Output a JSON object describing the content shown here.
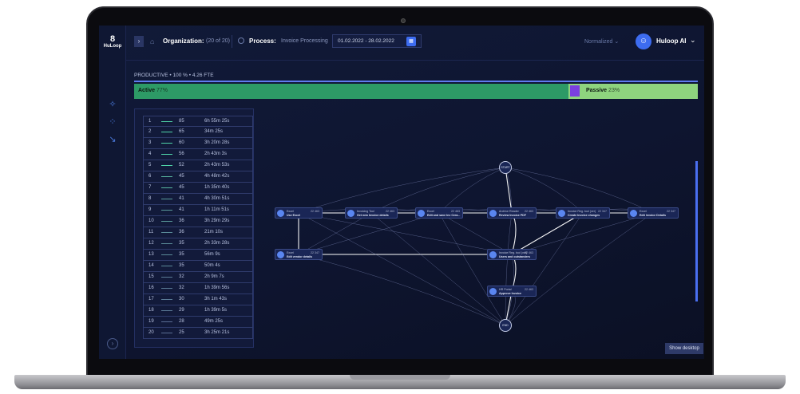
{
  "app": {
    "logo_mark": "8",
    "logo_text": "HuLoop"
  },
  "topbar": {
    "collapse_glyph": "›",
    "organization_label": "Organization:",
    "organization_value": "(20 of 20)",
    "process_label": "Process:",
    "process_value": "Invoice Processing",
    "date_range": "01.02.2022 - 28.02.2022",
    "normalization": "Normalized",
    "user_name": "Huloop AI"
  },
  "summary": {
    "productive_label": "PRODUCTIVE  •  100 %  •  4.26 FTE",
    "active_label": "Active",
    "active_pct": "77%",
    "active_fraction": 0.77,
    "passive_label": "Passive",
    "passive_pct": "23%",
    "colors": {
      "active": "#2d9a66",
      "passive": "#8ed47e",
      "passive_swatch": "#7b3fe0"
    }
  },
  "variants": [
    {
      "idx": "1",
      "count": "85",
      "duration": "6h 55m 25s"
    },
    {
      "idx": "2",
      "count": "65",
      "duration": "34m 25s"
    },
    {
      "idx": "3",
      "count": "60",
      "duration": "3h 20m 28s"
    },
    {
      "idx": "4",
      "count": "56",
      "duration": "2h 43m 3s"
    },
    {
      "idx": "5",
      "count": "52",
      "duration": "2h 43m 53s"
    },
    {
      "idx": "6",
      "count": "45",
      "duration": "4h 48m 42s"
    },
    {
      "idx": "7",
      "count": "45",
      "duration": "1h 35m 40s"
    },
    {
      "idx": "8",
      "count": "41",
      "duration": "4h 30m 51s"
    },
    {
      "idx": "9",
      "count": "41",
      "duration": "1h 11m 51s"
    },
    {
      "idx": "10",
      "count": "36",
      "duration": "3h 29m 29s"
    },
    {
      "idx": "11",
      "count": "36",
      "duration": "21m 10s"
    },
    {
      "idx": "12",
      "count": "35",
      "duration": "2h 33m 28s"
    },
    {
      "idx": "13",
      "count": "35",
      "duration": "56m 9s"
    },
    {
      "idx": "14",
      "count": "35",
      "duration": "50m 4s"
    },
    {
      "idx": "15",
      "count": "32",
      "duration": "2h 9m 7s"
    },
    {
      "idx": "16",
      "count": "32",
      "duration": "1h 39m 56s"
    },
    {
      "idx": "17",
      "count": "30",
      "duration": "3h 1m 43s"
    },
    {
      "idx": "18",
      "count": "29",
      "duration": "1h 39m 5s"
    },
    {
      "idx": "19",
      "count": "28",
      "duration": "49m 25s"
    },
    {
      "idx": "20",
      "count": "25",
      "duration": "3h 25m 21s"
    }
  ],
  "graph": {
    "start_label": "START",
    "end_label": "END",
    "nodes": [
      {
        "app": "Excel",
        "activity": "Use Excel",
        "count": "22 463"
      },
      {
        "app": "Invoicing Tool",
        "activity": "Get new Invoice details",
        "count": "22 463"
      },
      {
        "app": "Excel",
        "activity": "Edit and save Inv Crea...",
        "count": "22 463"
      },
      {
        "app": "Archive Reader",
        "activity": "Review Invoice PDF",
        "count": "22 463"
      },
      {
        "app": "Invoice Reg. tool (ver)",
        "activity": "Create Invoice changes",
        "count": "22 347"
      },
      {
        "app": "Excel",
        "activity": "Edit Invoice Details",
        "count": "22 347"
      },
      {
        "app": "Excel",
        "activity": "Edit vendor details",
        "count": "22 347"
      },
      {
        "app": "Invoice Reg. tool (ver)",
        "activity": "Users and outstanders",
        "count": "22 463"
      },
      {
        "app": "HR Portal",
        "activity": "Approve Invoice",
        "count": "22 463"
      }
    ]
  },
  "footer": {
    "show_desktop": "Show desktop"
  }
}
